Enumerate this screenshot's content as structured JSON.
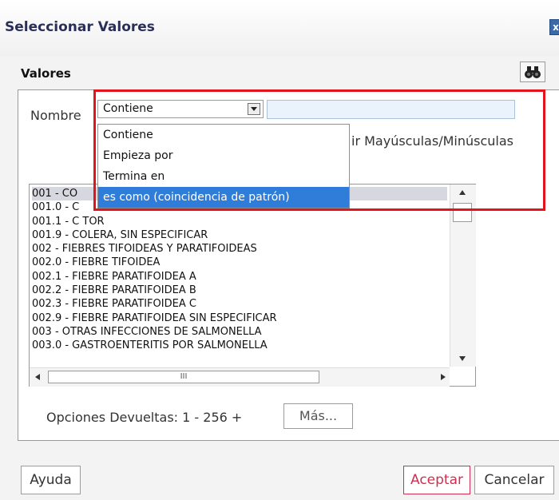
{
  "dialog": {
    "title": "Seleccionar Valores",
    "close_label": "x"
  },
  "section": {
    "label": "Valores"
  },
  "filter": {
    "name_label": "Nombre",
    "operator_selected": "Contiene",
    "text_value": "",
    "case_label": "ir Mayúsculas/Minúsculas",
    "dropdown_options": [
      "Contiene",
      "Empieza por",
      "Termina en",
      "es como (coincidencia de patrón)"
    ],
    "highlighted_option": "es como (coincidencia de patrón)"
  },
  "list": {
    "items": [
      "001 - CO",
      "001.0 - C",
      "001.1 - C                                                                        TOR",
      "001.9 - COLERA, SIN ESPECIFICAR",
      "002 - FIEBRES TIFOIDEAS Y PARATIFOIDEAS",
      "002.0 - FIEBRE TIFOIDEA",
      "002.1 - FIEBRE PARATIFOIDEA A",
      "002.2 - FIEBRE PARATIFOIDEA B",
      "002.3 - FIEBRE PARATIFOIDEA C",
      "002.9 - FIEBRE PARATIFOIDEA SIN ESPECIFICAR",
      "003 - OTRAS INFECCIONES DE SALMONELLA",
      "003.0 - GASTROENTERITIS POR SALMONELLA"
    ],
    "hscroll_grip": "III"
  },
  "results": {
    "text": "Opciones Devueltas: 1 - 256 +",
    "more_button": "Más..."
  },
  "footer": {
    "help": "Ayuda",
    "accept": "Aceptar",
    "cancel": "Cancelar"
  },
  "colors": {
    "accent": "#2f7dd8",
    "highlight": "#e4141c",
    "accept": "#d12f4f"
  }
}
